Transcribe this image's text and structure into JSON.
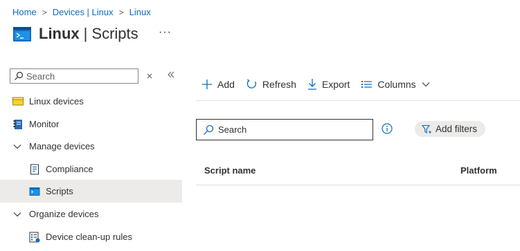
{
  "breadcrumb": {
    "items": [
      "Home",
      "Devices | Linux",
      "Linux"
    ]
  },
  "page": {
    "title_bold": "Linux",
    "title_separator": "|",
    "title_rest": "Scripts",
    "more_label": "···"
  },
  "sidebar": {
    "search_placeholder": "Search",
    "items": [
      {
        "label": "Linux devices",
        "icon": "folder-icon"
      },
      {
        "label": "Monitor",
        "icon": "monitor-book-icon"
      },
      {
        "label": "Manage devices",
        "icon": "chevron-down-icon"
      },
      {
        "label": "Compliance",
        "icon": "compliance-doc-icon"
      },
      {
        "label": "Scripts",
        "icon": "script-terminal-icon",
        "selected": true
      },
      {
        "label": "Organize devices",
        "icon": "chevron-down-icon"
      },
      {
        "label": "Device clean-up rules",
        "icon": "cleanup-rules-icon"
      }
    ]
  },
  "toolbar": {
    "add": "Add",
    "refresh": "Refresh",
    "export": "Export",
    "columns": "Columns"
  },
  "filters": {
    "search_placeholder": "Search",
    "add_filters": "Add filters"
  },
  "table": {
    "columns": [
      "Script name",
      "Platform"
    ]
  },
  "colors": {
    "accent": "#0f6cbd",
    "selected_bg": "#edebe9"
  }
}
